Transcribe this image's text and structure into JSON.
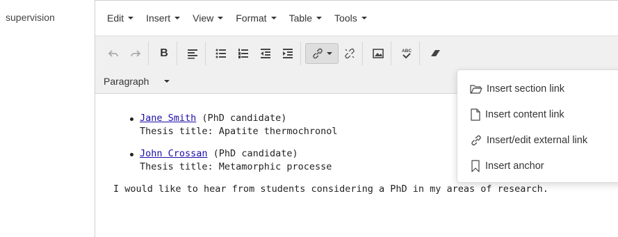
{
  "field_label": "supervision",
  "menubar": {
    "items": [
      {
        "label": "Edit",
        "icon": "chevron-down-icon"
      },
      {
        "label": "Insert",
        "icon": "chevron-down-icon"
      },
      {
        "label": "View",
        "icon": "chevron-down-icon"
      },
      {
        "label": "Format",
        "icon": "chevron-down-icon"
      },
      {
        "label": "Table",
        "icon": "chevron-down-icon"
      },
      {
        "label": "Tools",
        "icon": "chevron-down-icon"
      }
    ]
  },
  "toolbar": {
    "bold_label": "B",
    "buttons": [
      "undo-icon",
      "redo-icon",
      "bold-icon",
      "align-left-icon",
      "bullet-list-icon",
      "numbered-list-icon",
      "outdent-icon",
      "indent-icon",
      "link-icon",
      "unlink-icon",
      "image-icon",
      "spellcheck-icon",
      "eraser-icon"
    ],
    "spellcheck_label": "ABC",
    "format_select": "Paragraph"
  },
  "content": {
    "items": [
      {
        "name": "Jane Smith",
        "role": " (PhD candidate)",
        "thesis": "Thesis title: Apatite thermochronol"
      },
      {
        "name": "John Crossan",
        "role": " (PhD candidate)",
        "thesis": "Thesis title: Metamorphic processe"
      }
    ],
    "paragraph": "I would like to hear from students considering a PhD in my areas of research."
  },
  "link_menu": {
    "items": [
      {
        "label": "Insert section link",
        "icon": "folder-icon"
      },
      {
        "label": "Insert content link",
        "icon": "document-icon"
      },
      {
        "label": "Insert/edit external link",
        "icon": "link-icon"
      },
      {
        "label": "Insert anchor",
        "icon": "bookmark-icon"
      }
    ]
  }
}
